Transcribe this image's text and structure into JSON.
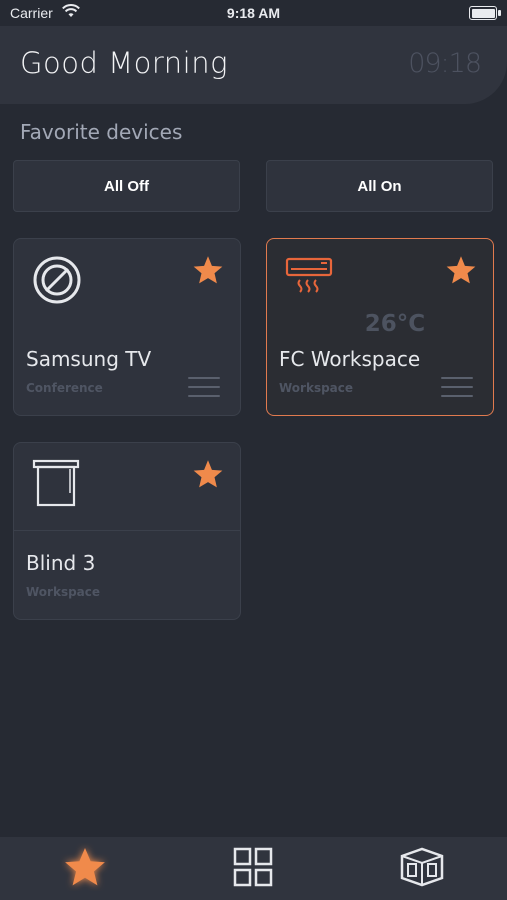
{
  "status": {
    "carrier": "Carrier",
    "time": "9:18 AM",
    "battery_level": 1.0
  },
  "header": {
    "greeting": "Good Morning",
    "clock": "09:18"
  },
  "favorites": {
    "title": "Favorite devices",
    "all_off_label": "All Off",
    "all_on_label": "All On",
    "devices": [
      {
        "name": "Samsung TV",
        "room": "Conference",
        "icon": "tv-off-icon",
        "favorite": true,
        "active": false
      },
      {
        "name": "FC Workspace",
        "room": "Workspace",
        "icon": "air-conditioner-icon",
        "temperature": "26°C",
        "favorite": true,
        "active": true
      },
      {
        "name": "Blind 3",
        "room": "Workspace",
        "icon": "blind-icon",
        "favorite": true,
        "active": false
      }
    ]
  },
  "tabs": [
    {
      "name": "favorites",
      "icon": "star-icon",
      "selected": true
    },
    {
      "name": "devices",
      "icon": "grid-icon",
      "selected": false
    },
    {
      "name": "rooms",
      "icon": "room-cube-icon",
      "selected": false
    }
  ],
  "colors": {
    "accent": "#f08a4b",
    "background": "#262a33",
    "card": "#2f333d",
    "active_border": "#e07a4f"
  }
}
